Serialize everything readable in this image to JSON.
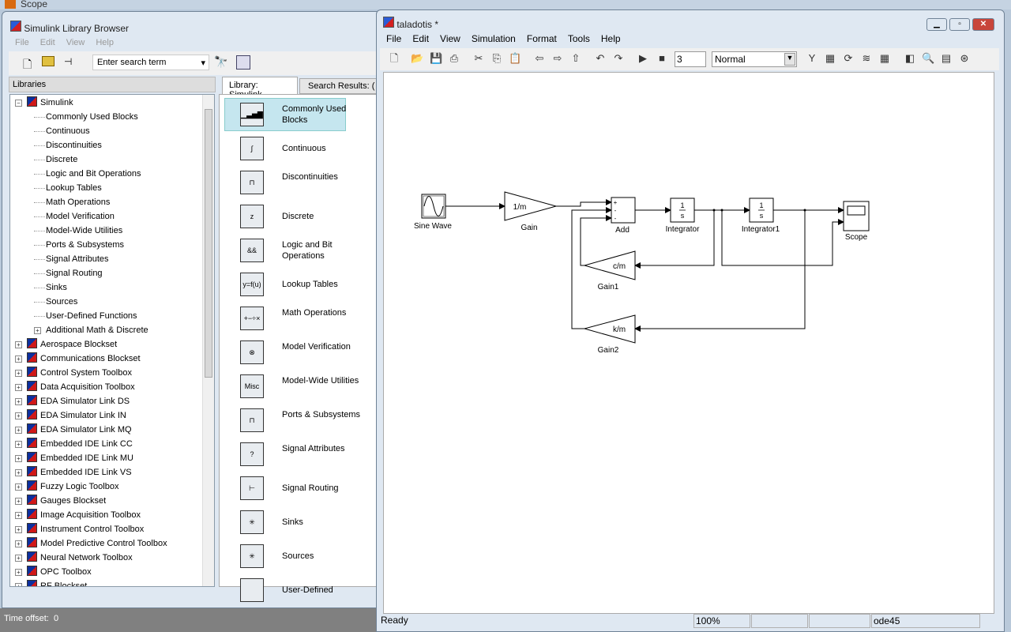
{
  "background_window": {
    "title": "Scope",
    "time_offset_label": "Time offset:",
    "time_offset_value": "0"
  },
  "library_browser": {
    "title": "Simulink Library Browser",
    "menu": [
      "File",
      "Edit",
      "View",
      "Help"
    ],
    "search_placeholder": "Enter search term",
    "libraries_header": "Libraries",
    "tabs": [
      "Library: Simulink",
      "Search Results: ("
    ],
    "tree": [
      {
        "label": "Simulink",
        "level": 0,
        "expanded": true
      },
      {
        "label": "Commonly Used Blocks",
        "level": 1
      },
      {
        "label": "Continuous",
        "level": 1
      },
      {
        "label": "Discontinuities",
        "level": 1
      },
      {
        "label": "Discrete",
        "level": 1
      },
      {
        "label": "Logic and Bit Operations",
        "level": 1
      },
      {
        "label": "Lookup Tables",
        "level": 1
      },
      {
        "label": "Math Operations",
        "level": 1
      },
      {
        "label": "Model Verification",
        "level": 1
      },
      {
        "label": "Model-Wide Utilities",
        "level": 1
      },
      {
        "label": "Ports & Subsystems",
        "level": 1
      },
      {
        "label": "Signal Attributes",
        "level": 1
      },
      {
        "label": "Signal Routing",
        "level": 1
      },
      {
        "label": "Sinks",
        "level": 1
      },
      {
        "label": "Sources",
        "level": 1
      },
      {
        "label": "User-Defined Functions",
        "level": 1
      },
      {
        "label": "Additional Math & Discrete",
        "level": 1,
        "expandable": true
      },
      {
        "label": "Aerospace Blockset",
        "level": 0
      },
      {
        "label": "Communications Blockset",
        "level": 0
      },
      {
        "label": "Control System Toolbox",
        "level": 0
      },
      {
        "label": "Data Acquisition Toolbox",
        "level": 0
      },
      {
        "label": "EDA Simulator Link DS",
        "level": 0
      },
      {
        "label": "EDA Simulator Link IN",
        "level": 0
      },
      {
        "label": "EDA Simulator Link MQ",
        "level": 0
      },
      {
        "label": "Embedded IDE Link CC",
        "level": 0
      },
      {
        "label": "Embedded IDE Link MU",
        "level": 0
      },
      {
        "label": "Embedded IDE Link VS",
        "level": 0
      },
      {
        "label": "Fuzzy Logic Toolbox",
        "level": 0
      },
      {
        "label": "Gauges Blockset",
        "level": 0
      },
      {
        "label": "Image Acquisition Toolbox",
        "level": 0
      },
      {
        "label": "Instrument Control Toolbox",
        "level": 0
      },
      {
        "label": "Model Predictive Control Toolbox",
        "level": 0
      },
      {
        "label": "Neural Network Toolbox",
        "level": 0
      },
      {
        "label": "OPC Toolbox",
        "level": 0
      },
      {
        "label": "RF Blockset",
        "level": 0
      }
    ],
    "blocks": [
      {
        "label": "Commonly Used Blocks",
        "icon": "bars",
        "selected": true
      },
      {
        "label": "Continuous",
        "icon": "∫"
      },
      {
        "label": "Discontinuities",
        "icon": "⊓"
      },
      {
        "label": "Discrete",
        "icon": "z"
      },
      {
        "label": "Logic and Bit Operations",
        "icon": "&&"
      },
      {
        "label": "Lookup Tables",
        "icon": "y=f(u)"
      },
      {
        "label": "Math Operations",
        "icon": "+−÷×"
      },
      {
        "label": "Model Verification",
        "icon": "⊗"
      },
      {
        "label": "Model-Wide Utilities",
        "icon": "Misc"
      },
      {
        "label": "Ports & Subsystems",
        "icon": "⊓"
      },
      {
        "label": "Signal Attributes",
        "icon": "?"
      },
      {
        "label": "Signal Routing",
        "icon": "⊢"
      },
      {
        "label": "Sinks",
        "icon": "✳"
      },
      {
        "label": "Sources",
        "icon": "✳"
      },
      {
        "label": "User-Defined",
        "icon": ""
      }
    ]
  },
  "model_window": {
    "title": "taladotis *",
    "menu": [
      "File",
      "Edit",
      "View",
      "Simulation",
      "Format",
      "Tools",
      "Help"
    ],
    "stop_time": "3",
    "sim_mode": "Normal",
    "status": {
      "text": "Ready",
      "zoom": "100%",
      "solver": "ode45"
    },
    "diagram": {
      "blocks": {
        "sine": "Sine Wave",
        "gain": "Gain",
        "gain_text": "1/m",
        "add": "Add",
        "add_signs": [
          "+",
          "-",
          "-"
        ],
        "int": "Integrator",
        "int1": "Integrator1",
        "int_text_num": "1",
        "int_text_den": "s",
        "scope": "Scope",
        "gain1": "Gain1",
        "gain1_text": "c/m",
        "gain2": "Gain2",
        "gain2_text": "k/m"
      }
    }
  }
}
